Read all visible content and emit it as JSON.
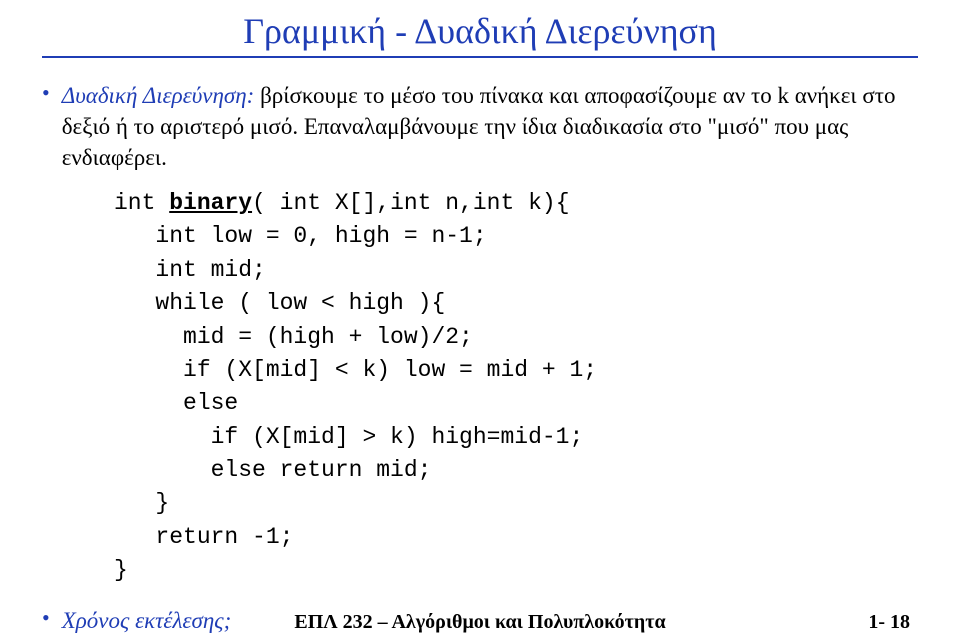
{
  "title": "Γραμμική  -  Δυαδική Διερεύνηση",
  "bullet1": {
    "lead": "Δυαδική Διερεύνηση:",
    "rest": " βρίσκουμε το μέσο του πίνακα και αποφασίζουμε αν το k ανήκει στο δεξιό ή το αριστερό μισό. Επαναλαμβάνουμε την ίδια διαδικασία στο \"μισό\" που μας ενδιαφέρει."
  },
  "code": {
    "l1a": "int ",
    "l1_kw": "binary",
    "l1b": "( int X[],int n,int k){",
    "l2": "   int low = 0, high = n-1;",
    "l3": "   int mid;",
    "l4": "   while ( low < high ){",
    "l5": "     mid = (high + low)/2;",
    "l6": "     if (X[mid] < k) low = mid + 1;",
    "l7": "     else",
    "l8": "       if (X[mid] > k) high=mid-1;",
    "l9": "       else return mid;",
    "l10": "   }",
    "l11": "   return -1;",
    "l12": "}"
  },
  "bullet2": "Χρόνος εκτέλεσης;",
  "footer": {
    "center": "ΕΠΛ 232 – Αλγόριθμοι και Πολυπλοκότητα",
    "right": "1- 18"
  }
}
